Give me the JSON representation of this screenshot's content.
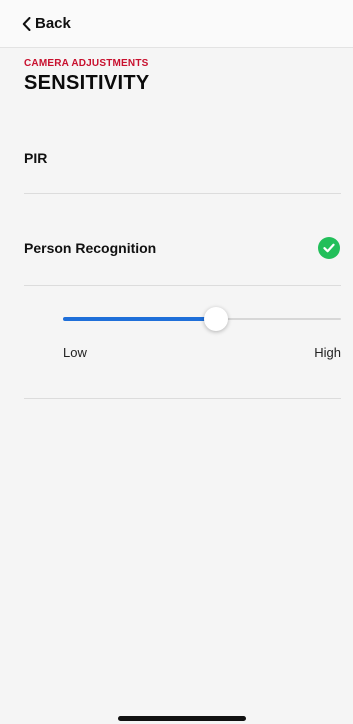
{
  "nav": {
    "back_label": "Back",
    "back_icon": "chevron-left-icon"
  },
  "header": {
    "section": "CAMERA ADJUSTMENTS",
    "title": "SENSITIVITY"
  },
  "options": [
    {
      "label": "PIR",
      "selected": false
    },
    {
      "label": "Person Recognition",
      "selected": true
    }
  ],
  "slider": {
    "min_label": "Low",
    "max_label": "High",
    "value_fraction": 0.55
  },
  "colors": {
    "accent_red": "#c8102e",
    "check_green": "#22bf5a",
    "slider_blue": "#1f6fd9"
  }
}
